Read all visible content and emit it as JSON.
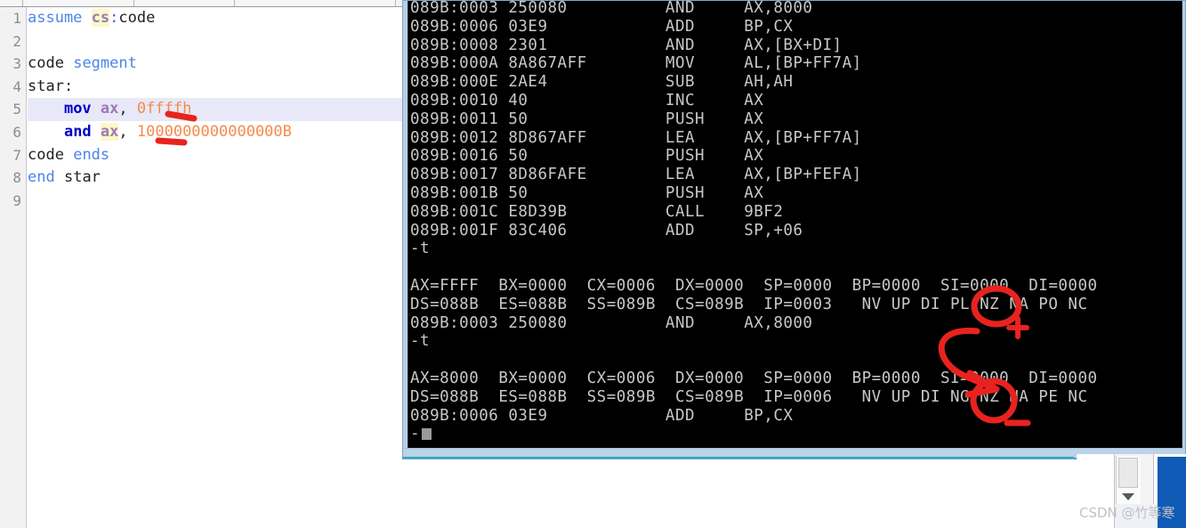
{
  "editor": {
    "gutter_numbers": [
      "1",
      "2",
      "3",
      "4",
      "5",
      "6",
      "7",
      "8",
      "9"
    ],
    "lines": [
      {
        "n": 1,
        "current": false,
        "tokens": [
          {
            "t": "assume",
            "c": "kw"
          },
          {
            "t": " ",
            "c": "plain"
          },
          {
            "t": "cs",
            "c": "kw-hl"
          },
          {
            "t": ":",
            "c": "punc"
          },
          {
            "t": "code",
            "c": "plain"
          }
        ]
      },
      {
        "n": 2,
        "current": false,
        "tokens": []
      },
      {
        "n": 3,
        "current": false,
        "tokens": [
          {
            "t": "code",
            "c": "plain"
          },
          {
            "t": " ",
            "c": "plain"
          },
          {
            "t": "segment",
            "c": "kw"
          }
        ]
      },
      {
        "n": 4,
        "current": false,
        "tokens": [
          {
            "t": "star:",
            "c": "plain"
          }
        ]
      },
      {
        "n": 5,
        "current": true,
        "tokens": [
          {
            "t": "    ",
            "c": "plain"
          },
          {
            "t": "mov",
            "c": "kw-b"
          },
          {
            "t": " ",
            "c": "plain"
          },
          {
            "t": "ax",
            "c": "reg"
          },
          {
            "t": ", ",
            "c": "plain"
          },
          {
            "t": "0ffffh",
            "c": "num"
          }
        ]
      },
      {
        "n": 6,
        "current": false,
        "tokens": [
          {
            "t": "    ",
            "c": "plain"
          },
          {
            "t": "and",
            "c": "kw-b"
          },
          {
            "t": " ",
            "c": "plain"
          },
          {
            "t": "ax",
            "c": "reg-hl"
          },
          {
            "t": ", ",
            "c": "plain"
          },
          {
            "t": "1000000000000000B",
            "c": "num"
          }
        ]
      },
      {
        "n": 7,
        "current": false,
        "tokens": [
          {
            "t": "code",
            "c": "plain"
          },
          {
            "t": " ",
            "c": "plain"
          },
          {
            "t": "ends",
            "c": "kw"
          }
        ]
      },
      {
        "n": 8,
        "current": false,
        "tokens": [
          {
            "t": "end",
            "c": "kw"
          },
          {
            "t": " ",
            "c": "plain"
          },
          {
            "t": "star",
            "c": "plain"
          }
        ]
      },
      {
        "n": 9,
        "current": false,
        "tokens": []
      }
    ]
  },
  "dos": {
    "lines": [
      "089B:0003 250080          AND     AX,8000",
      "089B:0006 03E9            ADD     BP,CX",
      "089B:0008 2301            AND     AX,[BX+DI]",
      "089B:000A 8A867AFF        MOV     AL,[BP+FF7A]",
      "089B:000E 2AE4            SUB     AH,AH",
      "089B:0010 40              INC     AX",
      "089B:0011 50              PUSH    AX",
      "089B:0012 8D867AFF        LEA     AX,[BP+FF7A]",
      "089B:0016 50              PUSH    AX",
      "089B:0017 8D86FAFE        LEA     AX,[BP+FEFA]",
      "089B:001B 50              PUSH    AX",
      "089B:001C E8D39B          CALL    9BF2",
      "089B:001F 83C406          ADD     SP,+06",
      "-t",
      "",
      "AX=FFFF  BX=0000  CX=0006  DX=0000  SP=0000  BP=0000  SI=0000  DI=0000",
      "DS=088B  ES=088B  SS=089B  CS=089B  IP=0003   NV UP DI PL NZ NA PO NC",
      "089B:0003 250080          AND     AX,8000",
      "-t",
      "",
      "AX=8000  BX=0000  CX=0006  DX=0000  SP=0000  BP=0000  SI=0000  DI=0000",
      "DS=088B  ES=088B  SS=089B  CS=089B  IP=0006   NV UP DI NG NZ NA PE NC",
      "089B:0006 03E9            ADD     BP,CX"
    ],
    "prompt": "-",
    "registers_before": {
      "AX": "FFFF",
      "BX": "0000",
      "CX": "0006",
      "DX": "0000",
      "SP": "0000",
      "BP": "0000",
      "SI": "0000",
      "DI": "0000",
      "DS": "088B",
      "ES": "088B",
      "SS": "089B",
      "CS": "089B",
      "IP": "0003",
      "flags": "NV UP DI PL NZ NA PO NC"
    },
    "registers_after": {
      "AX": "8000",
      "BX": "0000",
      "CX": "0006",
      "DX": "0000",
      "SP": "0000",
      "BP": "0000",
      "SI": "0000",
      "DI": "0000",
      "DS": "088B",
      "ES": "088B",
      "SS": "089B",
      "CS": "089B",
      "IP": "0006",
      "flags": "NV UP DI NG NZ NA PE NC"
    }
  },
  "annotations": {
    "color": "#e8231f",
    "circle_pl_label": "PL",
    "circle_ng_label": "NG",
    "plus_mark": "+",
    "minus_mark": "-",
    "underline_count": 2
  },
  "watermark": {
    "text": "CSDN @竹等寒"
  },
  "colors": {
    "keyword_blue": "#4a86e8",
    "instruction_blue": "#0000cc",
    "register_purple": "#9c7ab5",
    "number_orange": "#f58a4b",
    "highlight_yellow": "#fcf8c8",
    "current_line": "#e8e8f8",
    "dos_background": "#000000",
    "dos_text": "#c8c8c8",
    "dos_frame": "#b8cfe5",
    "annotation_red": "#e8231f",
    "taskbar_blue": "#0f5ab5"
  }
}
